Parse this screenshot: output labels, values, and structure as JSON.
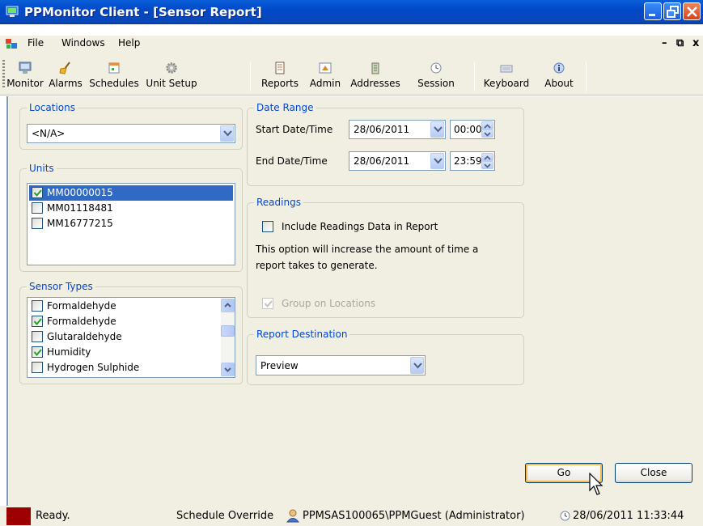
{
  "window": {
    "title": "PPMonitor Client - [Sensor Report]"
  },
  "menu": {
    "file": "File",
    "windows": "Windows",
    "help": "Help",
    "mdi_min": "–",
    "mdi_restore": "⧉",
    "mdi_close": "x"
  },
  "toolbar": {
    "items": [
      {
        "label": "Monitor",
        "icon": "monitor-icon"
      },
      {
        "label": "Alarms",
        "icon": "broom-icon"
      },
      {
        "label": "Schedules",
        "icon": "calendar-icon"
      },
      {
        "label": "Unit Setup",
        "icon": "gear-icon"
      },
      {
        "label": "Reports",
        "icon": "report-icon"
      },
      {
        "label": "Admin",
        "icon": "admin-icon"
      },
      {
        "label": "Addresses",
        "icon": "building-icon"
      },
      {
        "label": "Session",
        "icon": "clock-icon"
      },
      {
        "label": "Keyboard",
        "icon": "keyboard-icon"
      },
      {
        "label": "About",
        "icon": "info-icon"
      }
    ]
  },
  "locations": {
    "legend": "Locations",
    "selected": "<N/A>"
  },
  "units": {
    "legend": "Units",
    "items": [
      {
        "label": "MM00000015",
        "checked": true,
        "selected": true
      },
      {
        "label": "MM01118481",
        "checked": false,
        "selected": false
      },
      {
        "label": "MM16777215",
        "checked": false,
        "selected": false
      }
    ]
  },
  "sensor_types": {
    "legend": "Sensor Types",
    "items": [
      {
        "label": "Formaldehyde",
        "checked": false
      },
      {
        "label": "Formaldehyde",
        "checked": true
      },
      {
        "label": "Glutaraldehyde",
        "checked": false
      },
      {
        "label": "Humidity",
        "checked": true
      },
      {
        "label": "Hydrogen Sulphide",
        "checked": false
      }
    ]
  },
  "date_range": {
    "legend": "Date Range",
    "start_label": "Start Date/Time",
    "start_date": "28/06/2011",
    "start_time": "00:00",
    "end_label": "End Date/Time",
    "end_date": "28/06/2011",
    "end_time": "23:59"
  },
  "readings": {
    "legend": "Readings",
    "include_label": "Include Readings Data in Report",
    "include_checked": false,
    "note_line1": "This option will increase the amount of time a",
    "note_line2": "report takes to generate.",
    "group_label": "Group on Locations",
    "group_checked": true
  },
  "report_destination": {
    "legend": "Report Destination",
    "selected": "Preview"
  },
  "buttons": {
    "go": "Go",
    "close": "Close"
  },
  "status": {
    "ready": "Ready.",
    "schedule": "Schedule Override",
    "user": "PPMSAS100065\\PPMGuest (Administrator)",
    "datetime": "28/06/2011 11:33:44"
  }
}
